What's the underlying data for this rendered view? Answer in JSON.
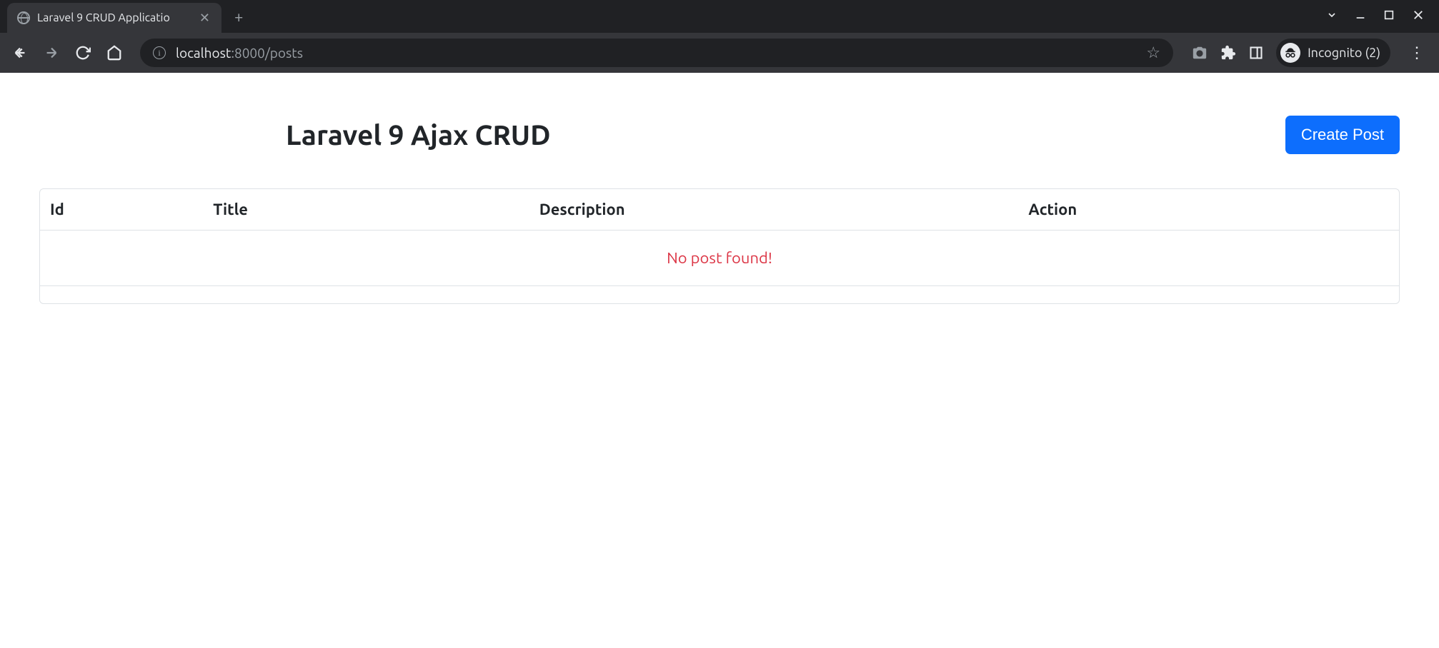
{
  "browser": {
    "tab_title": "Laravel 9 CRUD Applicatio",
    "url_host": "localhost",
    "url_port_path": ":8000/posts",
    "incognito_label": "Incognito (2)"
  },
  "page": {
    "title": "Laravel 9 Ajax CRUD",
    "create_button": "Create Post",
    "table": {
      "headers": {
        "id": "Id",
        "title": "Title",
        "description": "Description",
        "action": "Action"
      },
      "empty_message": "No post found!"
    }
  }
}
